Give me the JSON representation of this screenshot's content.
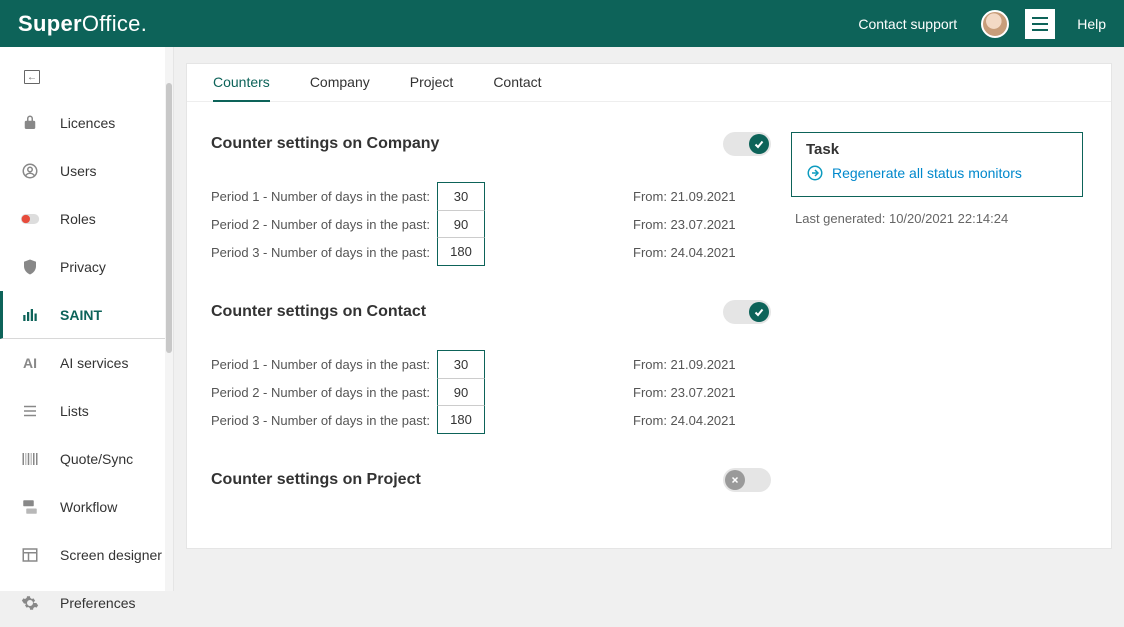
{
  "header": {
    "brand_bold": "Super",
    "brand_thin": "Office.",
    "contact_support": "Contact support",
    "help": "Help"
  },
  "sidebar": {
    "items": [
      {
        "label": "Licences"
      },
      {
        "label": "Users"
      },
      {
        "label": "Roles"
      },
      {
        "label": "Privacy"
      },
      {
        "label": "SAINT"
      },
      {
        "label": "AI services"
      },
      {
        "label": "Lists"
      },
      {
        "label": "Quote/Sync"
      },
      {
        "label": "Workflow"
      },
      {
        "label": "Screen designer"
      },
      {
        "label": "Preferences"
      }
    ]
  },
  "tabs": {
    "counters": "Counters",
    "company": "Company",
    "project": "Project",
    "contact": "Contact"
  },
  "sections": {
    "company": {
      "title": "Counter settings on Company",
      "periods": [
        {
          "label": "Period 1 - Number of days in the past:",
          "value": "30",
          "from": "From: 21.09.2021"
        },
        {
          "label": "Period 2 - Number of days in the past:",
          "value": "90",
          "from": "From: 23.07.2021"
        },
        {
          "label": "Period 3 - Number of days in the past:",
          "value": "180",
          "from": "From: 24.04.2021"
        }
      ]
    },
    "contact": {
      "title": "Counter settings on Contact",
      "periods": [
        {
          "label": "Period 1 - Number of days in the past:",
          "value": "30",
          "from": "From: 21.09.2021"
        },
        {
          "label": "Period 2 - Number of days in the past:",
          "value": "90",
          "from": "From: 23.07.2021"
        },
        {
          "label": "Period 3 - Number of days in the past:",
          "value": "180",
          "from": "From: 24.04.2021"
        }
      ]
    },
    "project": {
      "title": "Counter settings on Project"
    }
  },
  "task": {
    "title": "Task",
    "regenerate": "Regenerate all status monitors",
    "last_generated": "Last generated: 10/20/2021 22:14:24"
  }
}
